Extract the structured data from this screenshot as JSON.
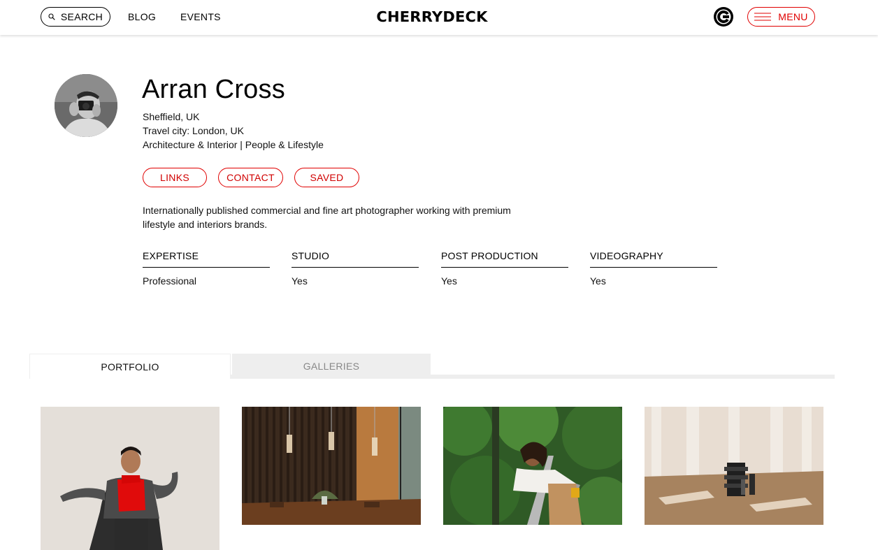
{
  "header": {
    "search_label": "SEARCH",
    "nav": [
      {
        "label": "BLOG"
      },
      {
        "label": "EVENTS"
      }
    ],
    "logo_text": "CHERRYDECK",
    "menu_label": "MENU",
    "icons": {
      "search": "search-icon",
      "brand": "cherrydeck-c-icon",
      "menu": "hamburger-icon"
    }
  },
  "profile": {
    "name": "Arran Cross",
    "location": "Sheffield, UK",
    "travel_city": "Travel city: London, UK",
    "specialties": "Architecture & Interior | People & Lifestyle",
    "actions": [
      {
        "label": "LINKS"
      },
      {
        "label": "CONTACT"
      },
      {
        "label": "SAVED"
      }
    ],
    "bio": "Internationally published commercial and fine art photographer working with premium lifestyle and interiors brands.",
    "specs": [
      {
        "label": "EXPERTISE",
        "value": "Professional"
      },
      {
        "label": "STUDIO",
        "value": "Yes"
      },
      {
        "label": "POST PRODUCTION",
        "value": "Yes"
      },
      {
        "label": "VIDEOGRAPHY",
        "value": "Yes"
      }
    ]
  },
  "tabs": [
    {
      "label": "PORTFOLIO",
      "active": true
    },
    {
      "label": "GALLERIES",
      "active": false
    }
  ],
  "colors": {
    "accent": "#e00000",
    "tab_inactive_bg": "#eeeeee",
    "text": "#111111"
  }
}
